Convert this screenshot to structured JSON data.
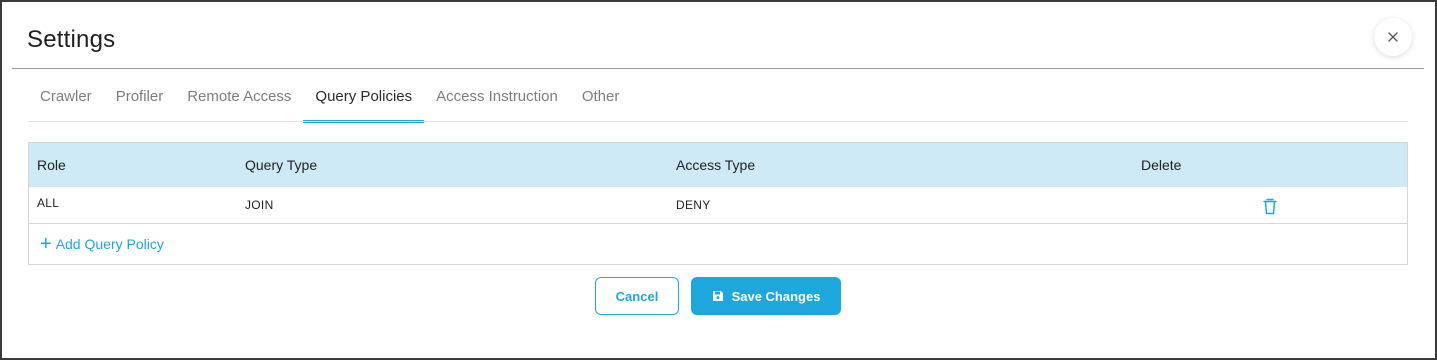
{
  "dialog": {
    "title": "Settings",
    "close_icon": "close-icon"
  },
  "tabs": [
    {
      "label": "Crawler",
      "active": false
    },
    {
      "label": "Profiler",
      "active": false
    },
    {
      "label": "Remote Access",
      "active": false
    },
    {
      "label": "Query Policies",
      "active": true
    },
    {
      "label": "Access Instruction",
      "active": false
    },
    {
      "label": "Other",
      "active": false
    }
  ],
  "table": {
    "headers": [
      "Role",
      "Query Type",
      "Access Type",
      "Delete"
    ],
    "rows": [
      {
        "role": "ALL",
        "query_type": "JOIN",
        "access_type": "DENY",
        "delete_icon": "trash-icon"
      }
    ],
    "add_label": "Add Query Policy"
  },
  "footer": {
    "cancel_label": "Cancel",
    "save_label": "Save Changes",
    "save_icon": "floppy-disk-icon"
  },
  "colors": {
    "accent": "#1ea7dc",
    "header_bg": "#cdeaf6"
  }
}
